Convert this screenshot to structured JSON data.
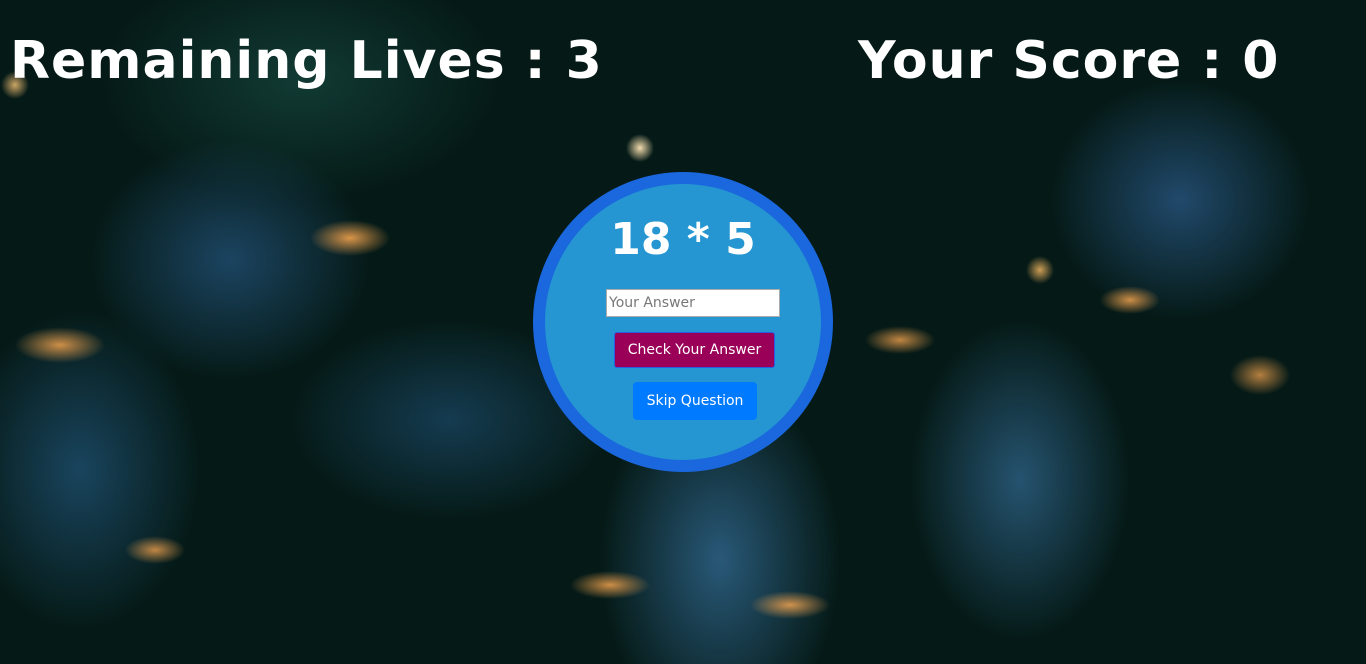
{
  "hud": {
    "lives_text": "Remaining Lives : 3",
    "lives": 3,
    "score_text": "Your Score : 0",
    "score": 0
  },
  "question": {
    "text": "18 * 5"
  },
  "answer_input": {
    "value": "",
    "placeholder": "Your Answer"
  },
  "buttons": {
    "check": "Check Your Answer",
    "skip": "Skip Question"
  },
  "colors": {
    "circle_fill": "#2596d1",
    "circle_border": "#1a67de",
    "check_button": "#9b0059",
    "skip_button": "#007bff"
  }
}
